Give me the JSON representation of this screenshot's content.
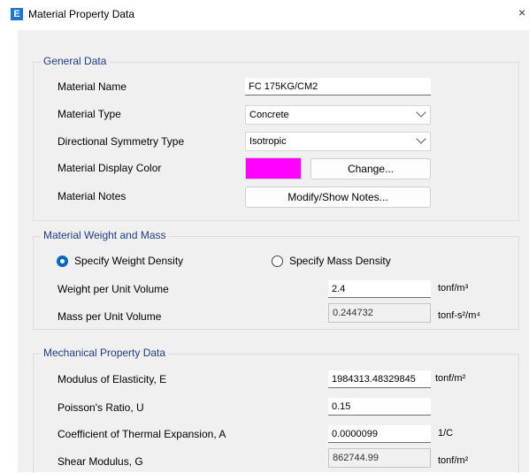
{
  "window": {
    "icon_letter": "E",
    "title": "Material Property Data",
    "close_glyph": "×"
  },
  "general_data": {
    "legend": "General Data",
    "material_name_label": "Material Name",
    "material_name_value": "FC 175KG/CM2",
    "material_type_label": "Material Type",
    "material_type_value": "Concrete",
    "symmetry_label": "Directional Symmetry Type",
    "symmetry_value": "Isotropic",
    "display_color_label": "Material Display Color",
    "display_color": "#ff00ff",
    "change_button": "Change...",
    "notes_label": "Material Notes",
    "notes_button": "Modify/Show Notes..."
  },
  "weight_mass": {
    "legend": "Material Weight and Mass",
    "radio_weight": "Specify Weight Density",
    "radio_mass": "Specify Mass Density",
    "selected": "weight",
    "weight_label": "Weight per Unit Volume",
    "weight_value": "2.4",
    "weight_unit": "tonf/m³",
    "mass_label": "Mass per Unit Volume",
    "mass_value": "0.244732",
    "mass_unit": "tonf-s²/m⁴"
  },
  "mechanical": {
    "legend": "Mechanical Property Data",
    "modulus_label": "Modulus of Elasticity,  E",
    "modulus_value": "1984313.48329845",
    "modulus_unit": "tonf/m²",
    "poisson_label": "Poisson's Ratio,  U",
    "poisson_value": "0.15",
    "thermal_label": "Coefficient of Thermal Expansion,  A",
    "thermal_value": "0.0000099",
    "thermal_unit": "1/C",
    "shear_label": "Shear Modulus,  G",
    "shear_value": "862744.99",
    "shear_unit": "tonf/m²"
  },
  "colors": {
    "accent": "#0067c0",
    "legend_text": "#1f3c88",
    "dialog_bg": "#f0f0f0"
  }
}
